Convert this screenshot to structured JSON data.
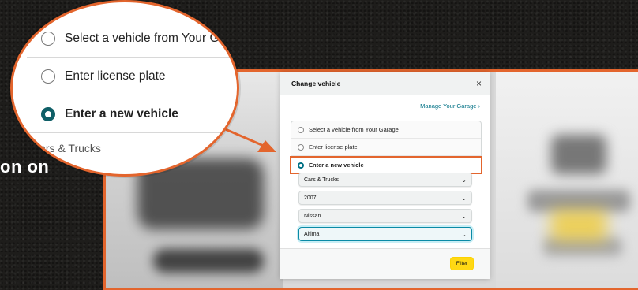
{
  "side_text": "on on",
  "dialog": {
    "title": "Change vehicle",
    "close_symbol": "×",
    "manage_link": "Manage Your Garage ›",
    "options": [
      {
        "label": "Select a vehicle from Your Garage",
        "selected": false
      },
      {
        "label": "Enter license plate",
        "selected": false
      },
      {
        "label": "Enter a new vehicle",
        "selected": true
      }
    ],
    "selects": [
      {
        "value": "Cars & Trucks"
      },
      {
        "value": "2007"
      },
      {
        "value": "Nissan"
      },
      {
        "value": "Altima"
      }
    ],
    "filter_label": "Filter"
  },
  "magnifier": {
    "options": [
      {
        "label": "Select a vehicle from Your G"
      },
      {
        "label": "Enter license plate"
      },
      {
        "label": "Enter a new vehicle"
      }
    ],
    "category": "Cars & Trucks"
  },
  "colors": {
    "highlight": "#e3652d",
    "radio_selected": "#0f5f67",
    "link": "#007185",
    "button": "#ffd814"
  }
}
